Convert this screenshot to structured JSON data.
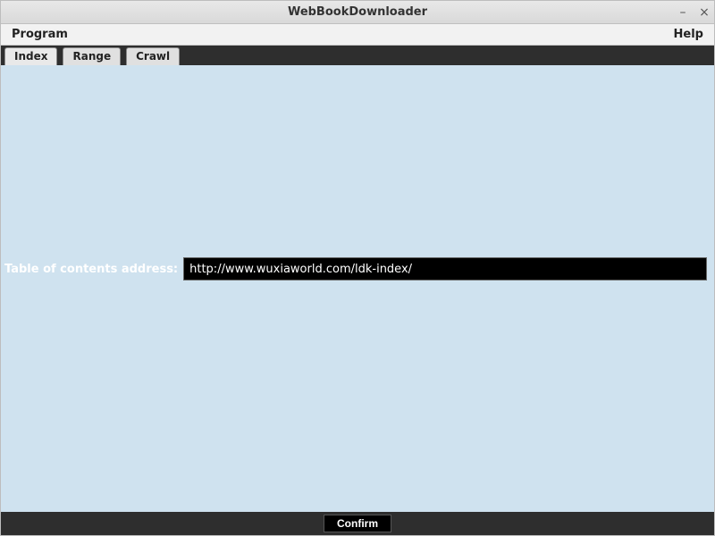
{
  "window": {
    "title": "WebBookDownloader"
  },
  "menubar": {
    "program": "Program",
    "help": "Help"
  },
  "tabs": {
    "index": "Index",
    "range": "Range",
    "crawl": "Crawl"
  },
  "form": {
    "label": "Table of contents address:",
    "value": "http://www.wuxiaworld.com/ldk-index/"
  },
  "buttons": {
    "confirm": "Confirm"
  }
}
